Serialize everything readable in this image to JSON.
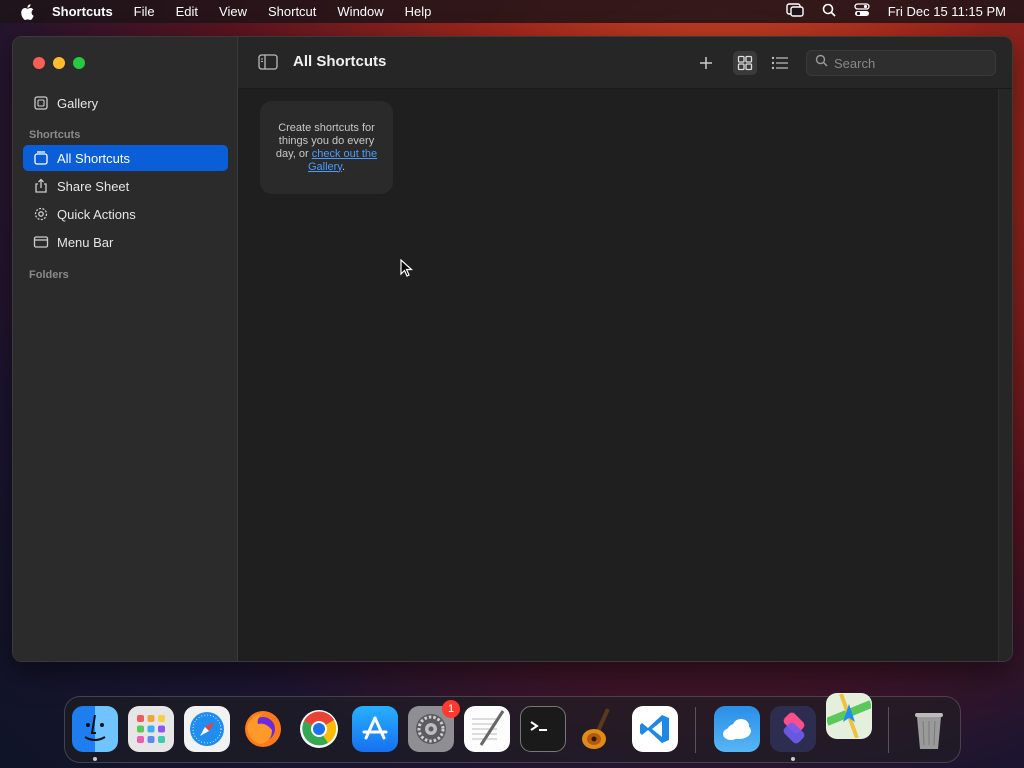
{
  "menubar": {
    "app_name": "Shortcuts",
    "items": [
      "File",
      "Edit",
      "View",
      "Shortcut",
      "Window",
      "Help"
    ],
    "clock": "Fri Dec 15  11:15 PM"
  },
  "sidebar": {
    "gallery_label": "Gallery",
    "shortcuts_section": "Shortcuts",
    "items": [
      {
        "label": "All Shortcuts",
        "icon": "shortcuts-stack-icon"
      },
      {
        "label": "Share Sheet",
        "icon": "share-icon"
      },
      {
        "label": "Quick Actions",
        "icon": "gear-icon"
      },
      {
        "label": "Menu Bar",
        "icon": "menubar-icon"
      }
    ],
    "folders_section": "Folders"
  },
  "toolbar": {
    "title": "All Shortcuts",
    "search_placeholder": "Search"
  },
  "empty_state": {
    "text": "Create shortcuts for things you do every day, or ",
    "link": "check out the Gallery",
    "suffix": "."
  },
  "dock": {
    "settings_badge": "1"
  },
  "colors": {
    "accent": "#0a5fd8",
    "link": "#4d9bff"
  }
}
